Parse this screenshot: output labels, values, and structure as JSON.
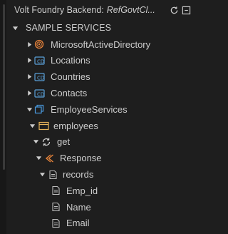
{
  "header": {
    "title_prefix": "Volt Foundry Backend:",
    "title_project": "RefGovtCl..."
  },
  "tree": {
    "root_label": "SAMPLE SERVICES",
    "services": [
      {
        "label": "MicrosoftActiveDirectory",
        "icon": "identity-service-icon"
      },
      {
        "label": "Locations",
        "icon": "object-service-icon"
      },
      {
        "label": "Countries",
        "icon": "object-service-icon"
      },
      {
        "label": "Contacts",
        "icon": "object-service-icon"
      },
      {
        "label": "EmployeeServices",
        "icon": "integration-service-icon"
      }
    ],
    "object_label": "employees",
    "operation_label": "get",
    "response_label": "Response",
    "records_label": "records",
    "fields": [
      "Emp_id",
      "Name",
      "Email"
    ]
  },
  "colors": {
    "background": "#1e1e1e",
    "text": "#cccccc",
    "identity_icon": "#e8833a",
    "object_icon": "#5aa0d8",
    "integration_icon": "#4a9be0",
    "folder_icon": "#e6b35a",
    "response_icon": "#e8843a"
  }
}
